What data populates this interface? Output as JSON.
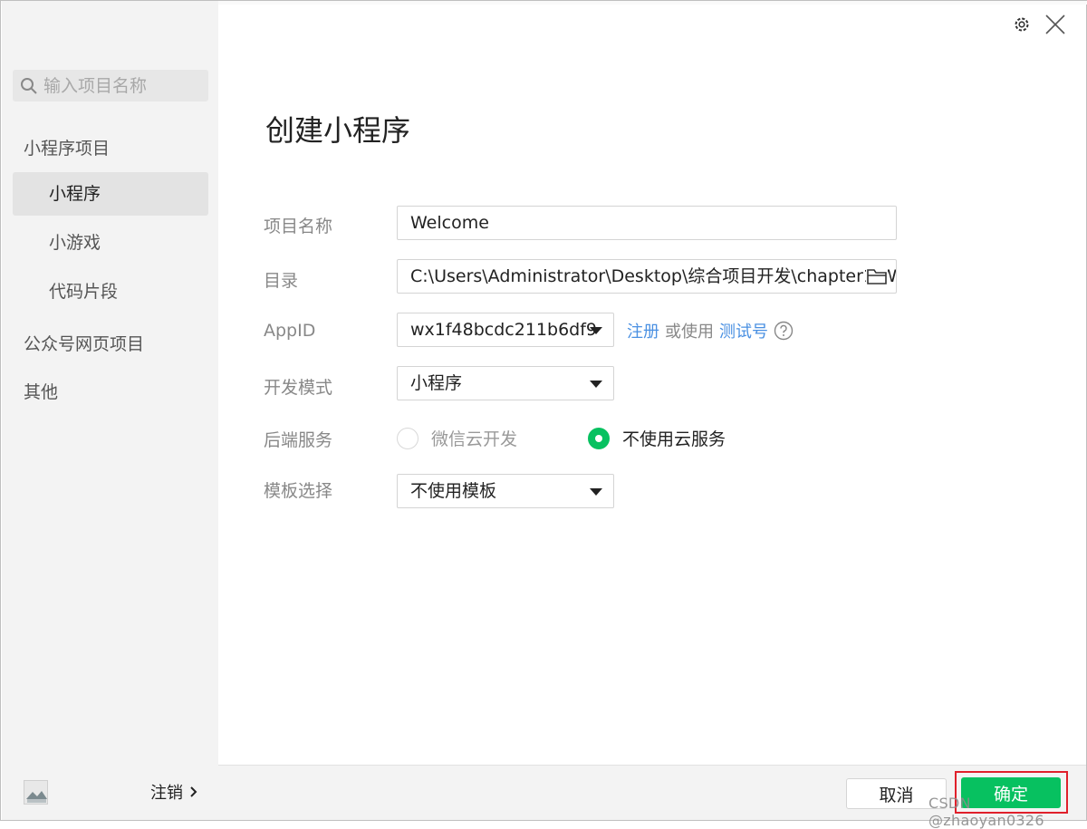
{
  "sidebar": {
    "search_placeholder": "输入项目名称",
    "groups": [
      {
        "label": "小程序项目"
      },
      {
        "label": "公众号网页项目"
      },
      {
        "label": "其他"
      }
    ],
    "items": [
      {
        "label": "小程序"
      },
      {
        "label": "小游戏"
      },
      {
        "label": "代码片段"
      }
    ],
    "logout_label": "注销"
  },
  "header": {
    "title": "创建小程序"
  },
  "form": {
    "project_name": {
      "label": "项目名称",
      "value": "Welcome"
    },
    "directory": {
      "label": "目录",
      "value": "C:\\Users\\Administrator\\Desktop\\综合项目开发\\chapter1\\W"
    },
    "appid": {
      "label": "AppID",
      "value": "wx1f48bcdc211b6df9",
      "register_link": "注册",
      "or_text": "或使用",
      "test_link": "测试号"
    },
    "dev_mode": {
      "label": "开发模式",
      "value": "小程序"
    },
    "backend": {
      "label": "后端服务",
      "option1": "微信云开发",
      "option2": "不使用云服务"
    },
    "template": {
      "label": "模板选择",
      "value": "不使用模板"
    }
  },
  "footer": {
    "cancel_label": "取消",
    "ok_label": "确定"
  },
  "watermark": "CSDN @zhaoyan0326",
  "colors": {
    "accent": "#07c160",
    "link": "#4a90e2",
    "highlight": "#e0202b"
  }
}
